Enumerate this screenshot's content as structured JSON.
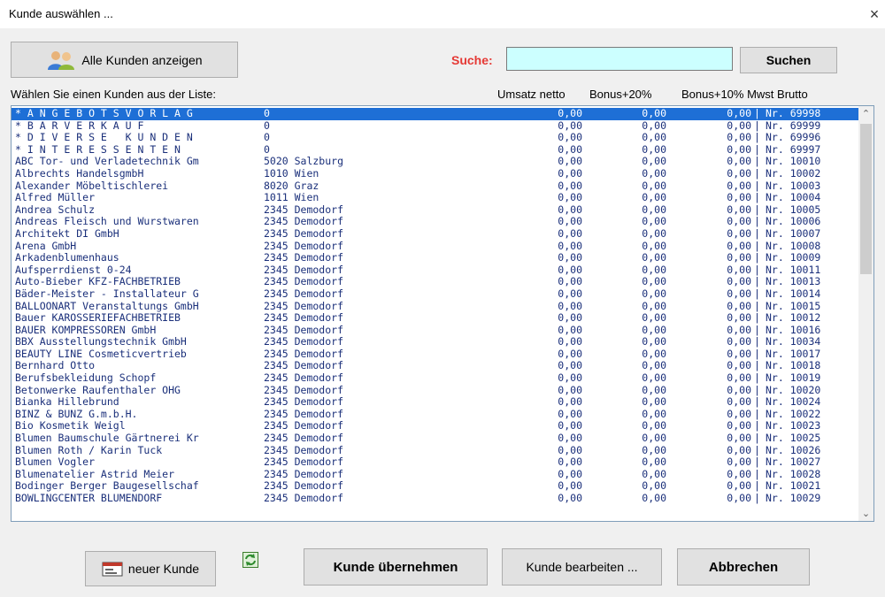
{
  "window": {
    "title": "Kunde auswählen ...",
    "close_glyph": "×"
  },
  "toolbar": {
    "all_customers_label": "Alle Kunden anzeigen",
    "search_label": "Suche:",
    "search_value": "",
    "search_button": "Suchen"
  },
  "list": {
    "header": {
      "prompt": "Wählen Sie einen Kunden aus der Liste:",
      "col_netto": "Umsatz netto",
      "col_bonus20": "Bonus+20%",
      "col_bonus10": "Bonus+10% Mwst Brutto"
    },
    "selected_index": 0,
    "rows": [
      {
        "name": "* A N G E B O T S V O R L A G",
        "plz": "0",
        "city": "",
        "v1": "0,00",
        "v2": "0,00",
        "v3": "0,00",
        "nr": "Nr. 69998"
      },
      {
        "name": "* B A R V E R K A U F",
        "plz": "0",
        "city": "",
        "v1": "0,00",
        "v2": "0,00",
        "v3": "0,00",
        "nr": "Nr. 69999"
      },
      {
        "name": "* D I V E R S E   K U N D E N",
        "plz": "0",
        "city": "",
        "v1": "0,00",
        "v2": "0,00",
        "v3": "0,00",
        "nr": "Nr. 69996"
      },
      {
        "name": "* I N T E R E S S E N T E N",
        "plz": "0",
        "city": "",
        "v1": "0,00",
        "v2": "0,00",
        "v3": "0,00",
        "nr": "Nr. 69997"
      },
      {
        "name": "ABC Tor- und Verladetechnik Gm",
        "plz": "5020",
        "city": "Salzburg",
        "v1": "0,00",
        "v2": "0,00",
        "v3": "0,00",
        "nr": "Nr. 10010"
      },
      {
        "name": "Albrechts HandelsgmbH",
        "plz": "1010",
        "city": "Wien",
        "v1": "0,00",
        "v2": "0,00",
        "v3": "0,00",
        "nr": "Nr. 10002"
      },
      {
        "name": "Alexander Möbeltischlerei",
        "plz": "8020",
        "city": "Graz",
        "v1": "0,00",
        "v2": "0,00",
        "v3": "0,00",
        "nr": "Nr. 10003"
      },
      {
        "name": "Alfred Müller",
        "plz": "1011",
        "city": "Wien",
        "v1": "0,00",
        "v2": "0,00",
        "v3": "0,00",
        "nr": "Nr. 10004"
      },
      {
        "name": "Andrea Schulz",
        "plz": "2345",
        "city": "Demodorf",
        "v1": "0,00",
        "v2": "0,00",
        "v3": "0,00",
        "nr": "Nr. 10005"
      },
      {
        "name": "Andreas Fleisch und Wurstwaren",
        "plz": "2345",
        "city": "Demodorf",
        "v1": "0,00",
        "v2": "0,00",
        "v3": "0,00",
        "nr": "Nr. 10006"
      },
      {
        "name": "Architekt DI GmbH",
        "plz": "2345",
        "city": "Demodorf",
        "v1": "0,00",
        "v2": "0,00",
        "v3": "0,00",
        "nr": "Nr. 10007"
      },
      {
        "name": "Arena GmbH",
        "plz": "2345",
        "city": "Demodorf",
        "v1": "0,00",
        "v2": "0,00",
        "v3": "0,00",
        "nr": "Nr. 10008"
      },
      {
        "name": "Arkadenblumenhaus",
        "plz": "2345",
        "city": "Demodorf",
        "v1": "0,00",
        "v2": "0,00",
        "v3": "0,00",
        "nr": "Nr. 10009"
      },
      {
        "name": "Aufsperrdienst 0-24",
        "plz": "2345",
        "city": "Demodorf",
        "v1": "0,00",
        "v2": "0,00",
        "v3": "0,00",
        "nr": "Nr. 10011"
      },
      {
        "name": "Auto-Bieber KFZ-FACHBETRIEB",
        "plz": "2345",
        "city": "Demodorf",
        "v1": "0,00",
        "v2": "0,00",
        "v3": "0,00",
        "nr": "Nr. 10013"
      },
      {
        "name": "Bäder-Meister - Installateur G",
        "plz": "2345",
        "city": "Demodorf",
        "v1": "0,00",
        "v2": "0,00",
        "v3": "0,00",
        "nr": "Nr. 10014"
      },
      {
        "name": "BALLOONART Veranstaltungs GmbH",
        "plz": "2345",
        "city": "Demodorf",
        "v1": "0,00",
        "v2": "0,00",
        "v3": "0,00",
        "nr": "Nr. 10015"
      },
      {
        "name": "Bauer KAROSSERIEFACHBETRIEB",
        "plz": "2345",
        "city": "Demodorf",
        "v1": "0,00",
        "v2": "0,00",
        "v3": "0,00",
        "nr": "Nr. 10012"
      },
      {
        "name": "BAUER KOMPRESSOREN GmbH",
        "plz": "2345",
        "city": "Demodorf",
        "v1": "0,00",
        "v2": "0,00",
        "v3": "0,00",
        "nr": "Nr. 10016"
      },
      {
        "name": "BBX Ausstellungstechnik GmbH",
        "plz": "2345",
        "city": "Demodorf",
        "v1": "0,00",
        "v2": "0,00",
        "v3": "0,00",
        "nr": "Nr. 10034"
      },
      {
        "name": "BEAUTY LINE Cosmeticvertrieb",
        "plz": "2345",
        "city": "Demodorf",
        "v1": "0,00",
        "v2": "0,00",
        "v3": "0,00",
        "nr": "Nr. 10017"
      },
      {
        "name": "Bernhard Otto",
        "plz": "2345",
        "city": "Demodorf",
        "v1": "0,00",
        "v2": "0,00",
        "v3": "0,00",
        "nr": "Nr. 10018"
      },
      {
        "name": "Berufsbekleidung Schopf",
        "plz": "2345",
        "city": "Demodorf",
        "v1": "0,00",
        "v2": "0,00",
        "v3": "0,00",
        "nr": "Nr. 10019"
      },
      {
        "name": "Betonwerke Raufenthaler OHG",
        "plz": "2345",
        "city": "Demodorf",
        "v1": "0,00",
        "v2": "0,00",
        "v3": "0,00",
        "nr": "Nr. 10020"
      },
      {
        "name": "Bianka Hillebrund",
        "plz": "2345",
        "city": "Demodorf",
        "v1": "0,00",
        "v2": "0,00",
        "v3": "0,00",
        "nr": "Nr. 10024"
      },
      {
        "name": "BINZ & BUNZ G.m.b.H.",
        "plz": "2345",
        "city": "Demodorf",
        "v1": "0,00",
        "v2": "0,00",
        "v3": "0,00",
        "nr": "Nr. 10022"
      },
      {
        "name": "Bio Kosmetik Weigl",
        "plz": "2345",
        "city": "Demodorf",
        "v1": "0,00",
        "v2": "0,00",
        "v3": "0,00",
        "nr": "Nr. 10023"
      },
      {
        "name": "Blumen Baumschule Gärtnerei Kr",
        "plz": "2345",
        "city": "Demodorf",
        "v1": "0,00",
        "v2": "0,00",
        "v3": "0,00",
        "nr": "Nr. 10025"
      },
      {
        "name": "Blumen Roth / Karin Tuck",
        "plz": "2345",
        "city": "Demodorf",
        "v1": "0,00",
        "v2": "0,00",
        "v3": "0,00",
        "nr": "Nr. 10026"
      },
      {
        "name": "Blumen Vogler",
        "plz": "2345",
        "city": "Demodorf",
        "v1": "0,00",
        "v2": "0,00",
        "v3": "0,00",
        "nr": "Nr. 10027"
      },
      {
        "name": "Blumenatelier Astrid Meier",
        "plz": "2345",
        "city": "Demodorf",
        "v1": "0,00",
        "v2": "0,00",
        "v3": "0,00",
        "nr": "Nr. 10028"
      },
      {
        "name": "Bodinger Berger Baugesellschaf",
        "plz": "2345",
        "city": "Demodorf",
        "v1": "0,00",
        "v2": "0,00",
        "v3": "0,00",
        "nr": "Nr. 10021"
      },
      {
        "name": "BOWLINGCENTER BLUMENDORF",
        "plz": "2345",
        "city": "Demodorf",
        "v1": "0,00",
        "v2": "0,00",
        "v3": "0,00",
        "nr": "Nr. 10029"
      }
    ],
    "separator": "|"
  },
  "footer": {
    "new_customer": "neuer Kunde",
    "take_customer": "Kunde übernehmen",
    "edit_customer": "Kunde bearbeiten ...",
    "cancel": "Abbrechen"
  },
  "icons": {
    "people": "people-icon",
    "card": "customer-card-icon",
    "refresh": "refresh-icon",
    "close": "close-icon",
    "scroll_up": "scroll-up-icon",
    "scroll_down": "scroll-down-icon"
  },
  "colors": {
    "search_label": "#e53935",
    "search_bg": "#ccffff",
    "selection": "#1e6fd6",
    "row_text": "#1a2f7a"
  }
}
